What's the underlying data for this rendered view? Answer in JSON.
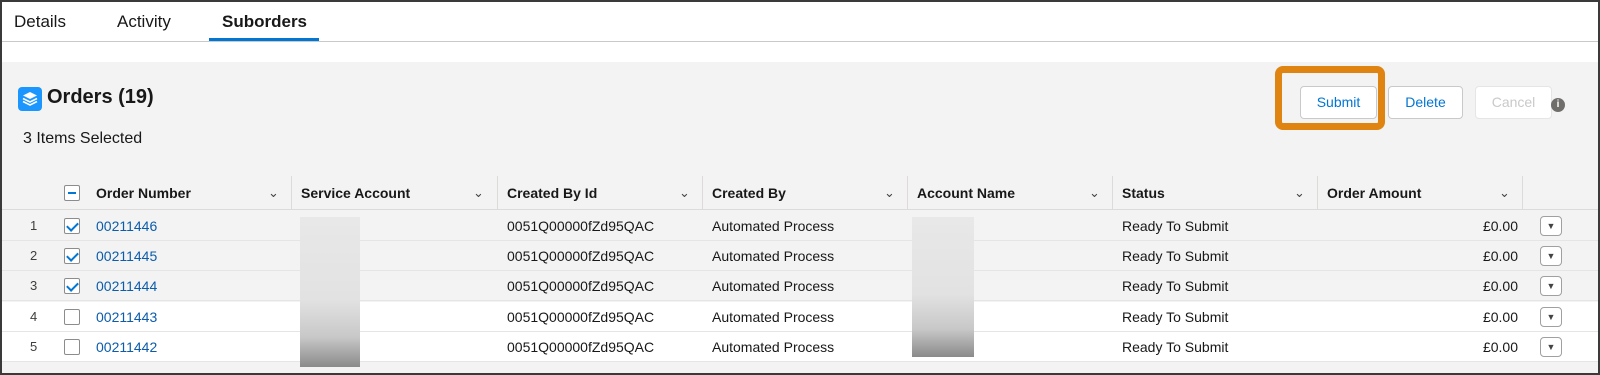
{
  "tabs": [
    {
      "label": "Details"
    },
    {
      "label": "Activity"
    },
    {
      "label": "Suborders"
    }
  ],
  "card": {
    "title": "Orders (19)",
    "selected_text": "3 Items Selected",
    "icon": "stacked-layers-icon",
    "icon_color": "#1b96ff"
  },
  "actions": {
    "submit": "Submit",
    "delete": "Delete",
    "cancel": "Cancel",
    "highlight_color": "#e08411"
  },
  "table": {
    "columns": [
      "Order Number",
      "Service Account",
      "Created By Id",
      "Created By",
      "Account Name",
      "Status",
      "Order Amount"
    ],
    "rows": [
      {
        "num": "1",
        "checked": true,
        "order": "00211446",
        "service_account": "",
        "created_by_id": "0051Q00000fZd95QAC",
        "created_by": "Automated Process",
        "account_name": "",
        "status": "Ready To Submit",
        "amount": "£0.00"
      },
      {
        "num": "2",
        "checked": true,
        "order": "00211445",
        "service_account": "",
        "created_by_id": "0051Q00000fZd95QAC",
        "created_by": "Automated Process",
        "account_name": "",
        "status": "Ready To Submit",
        "amount": "£0.00"
      },
      {
        "num": "3",
        "checked": true,
        "order": "00211444",
        "service_account": "",
        "created_by_id": "0051Q00000fZd95QAC",
        "created_by": "Automated Process",
        "account_name": "",
        "status": "Ready To Submit",
        "amount": "£0.00"
      },
      {
        "num": "4",
        "checked": false,
        "order": "00211443",
        "service_account": "",
        "created_by_id": "0051Q00000fZd95QAC",
        "created_by": "Automated Process",
        "account_name": "",
        "status": "Ready To Submit",
        "amount": "£0.00"
      },
      {
        "num": "5",
        "checked": false,
        "order": "00211442",
        "service_account": "",
        "created_by_id": "0051Q00000fZd95QAC",
        "created_by": "Automated Process",
        "account_name": "",
        "status": "Ready To Submit",
        "amount": "£0.00"
      }
    ]
  },
  "colors": {
    "link": "#0b5cab",
    "brand": "#0176d3"
  }
}
